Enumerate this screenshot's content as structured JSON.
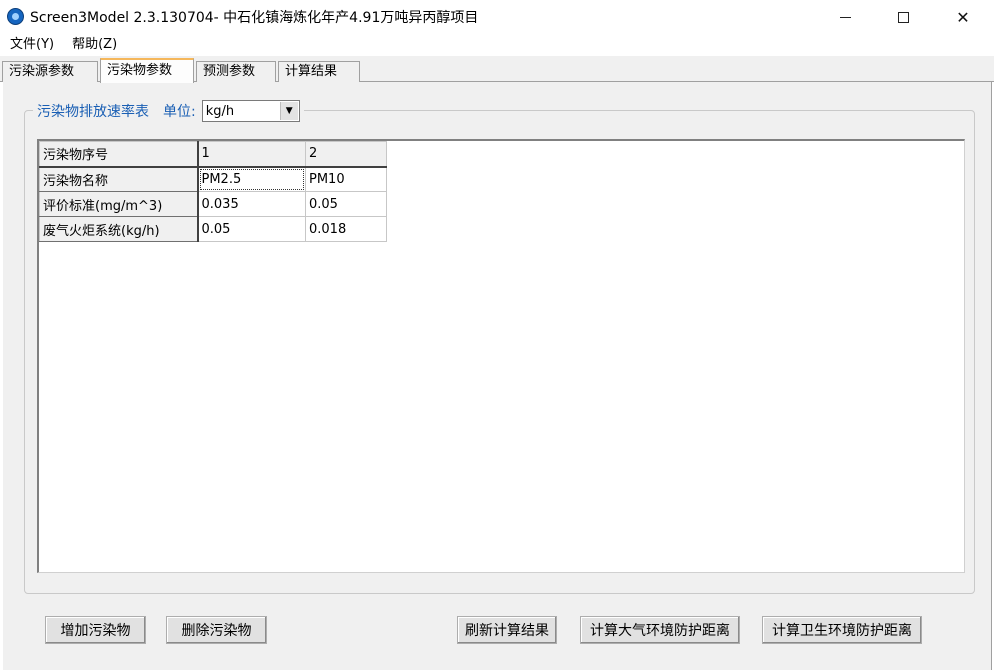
{
  "window": {
    "title": "Screen3Model 2.3.130704- 中石化镇海炼化年产4.91万吨异丙醇项目",
    "minimize_glyph": "",
    "close_glyph": "✕"
  },
  "menu": [
    "文件(Y)",
    "帮助(Z)"
  ],
  "tabs": [
    {
      "label": "污染源参数",
      "active": false
    },
    {
      "label": "污染物参数",
      "active": true
    },
    {
      "label": "预测参数",
      "active": false
    },
    {
      "label": "计算结果",
      "active": false
    }
  ],
  "group": {
    "title": "污染物排放速率表",
    "unit_label": "单位:",
    "unit_value": "kg/h"
  },
  "table": {
    "headers": [
      "污染物序号",
      "1",
      "2"
    ],
    "rows": [
      [
        "污染物名称",
        "PM2.5",
        "PM10"
      ],
      [
        "评价标准(mg/m^3)",
        "0.035",
        "0.05"
      ],
      [
        "废气火炬系统(kg/h)",
        "0.05",
        "0.018"
      ]
    ]
  },
  "buttons": {
    "add": "增加污染物",
    "delete": "删除污染物",
    "refresh": "刷新计算结果",
    "atmospheric": "计算大气环境防护距离",
    "health": "计算卫生环境防护距离"
  },
  "colors": {
    "accent": "#1a5fb4",
    "active_tab_border": "#f5b75b",
    "panel_bg": "#f0f0f0"
  },
  "icons": [
    "app-icon",
    "minimize-icon",
    "maximize-icon",
    "close-icon",
    "dropdown-arrow-icon"
  ]
}
